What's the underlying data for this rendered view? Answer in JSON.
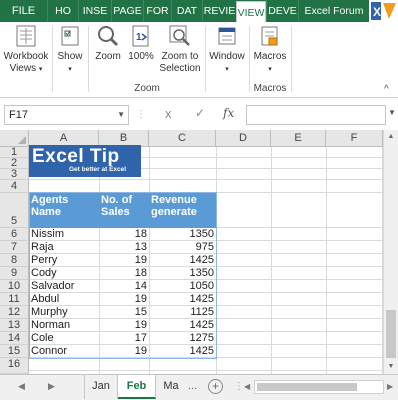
{
  "ribbon_tabs": {
    "file": "FILE",
    "items": [
      {
        "label": "HO",
        "active": false
      },
      {
        "label": "INSE",
        "active": false
      },
      {
        "label": "PAGE",
        "active": false
      },
      {
        "label": "FOR",
        "active": false
      },
      {
        "label": "DAT",
        "active": false
      },
      {
        "label": "REVIE",
        "active": false
      },
      {
        "label": "VIEW",
        "active": true
      },
      {
        "label": "DEVE",
        "active": false
      },
      {
        "label": "Excel Forum",
        "active": false
      }
    ]
  },
  "ribbon": {
    "workbook_views": {
      "line1": "Workbook",
      "line2": "Views",
      "icon": "workbook-views-icon"
    },
    "show": {
      "label": "Show",
      "icon": "show-icon"
    },
    "zoom": {
      "label": "Zoom",
      "icon": "magnifier-icon"
    },
    "zoom100": {
      "label": "100%",
      "icon": "zoom-100-icon"
    },
    "zoom_selection": {
      "line1": "Zoom to",
      "line2": "Selection",
      "icon": "zoom-to-selection-icon"
    },
    "window": {
      "label": "Window",
      "icon": "window-icon"
    },
    "macros": {
      "label": "Macros",
      "icon": "macros-icon"
    },
    "group_zoom": "Zoom",
    "group_macros": "Macros",
    "collapse_icon": "chevron-up-icon"
  },
  "formula_bar": {
    "name_box": "F17",
    "fx": "fx",
    "cancel_icon": "x",
    "enter_icon": "✓",
    "formula": ""
  },
  "grid": {
    "columns": [
      "A",
      "B",
      "C",
      "D",
      "E",
      "F"
    ],
    "rows": [
      "1",
      "2",
      "3",
      "4",
      "5",
      "6",
      "7",
      "8",
      "9",
      "10",
      "11",
      "12",
      "13",
      "14",
      "15",
      "16"
    ]
  },
  "banner": {
    "title": "Excel Tip",
    "tagline": "Get better at Excel"
  },
  "table": {
    "headers": [
      {
        "line1": "Agents",
        "line2": "Name"
      },
      {
        "line1": "No. of",
        "line2": "Sales"
      },
      {
        "line1": "Revenue",
        "line2": "generate"
      }
    ],
    "rows": [
      {
        "name": "Nissim",
        "sales": "18",
        "revenue": "1350"
      },
      {
        "name": "Raja",
        "sales": "13",
        "revenue": "975"
      },
      {
        "name": "Perry",
        "sales": "19",
        "revenue": "1425"
      },
      {
        "name": "Cody",
        "sales": "18",
        "revenue": "1350"
      },
      {
        "name": "Salvador",
        "sales": "14",
        "revenue": "1050"
      },
      {
        "name": "Abdul",
        "sales": "19",
        "revenue": "1425"
      },
      {
        "name": "Murphy",
        "sales": "15",
        "revenue": "1125"
      },
      {
        "name": "Norman",
        "sales": "19",
        "revenue": "1425"
      },
      {
        "name": "Cole",
        "sales": "17",
        "revenue": "1275"
      },
      {
        "name": "Connor",
        "sales": "19",
        "revenue": "1425"
      }
    ]
  },
  "sheets": {
    "tabs": [
      {
        "label": "Jan",
        "active": false
      },
      {
        "label": "Feb",
        "active": true
      },
      {
        "label": "Ma",
        "active": false
      }
    ],
    "more": "...",
    "add": "+"
  },
  "colors": {
    "excel_green": "#217346",
    "table_header": "#5b9bd5",
    "banner_blue": "#2f64ab"
  }
}
